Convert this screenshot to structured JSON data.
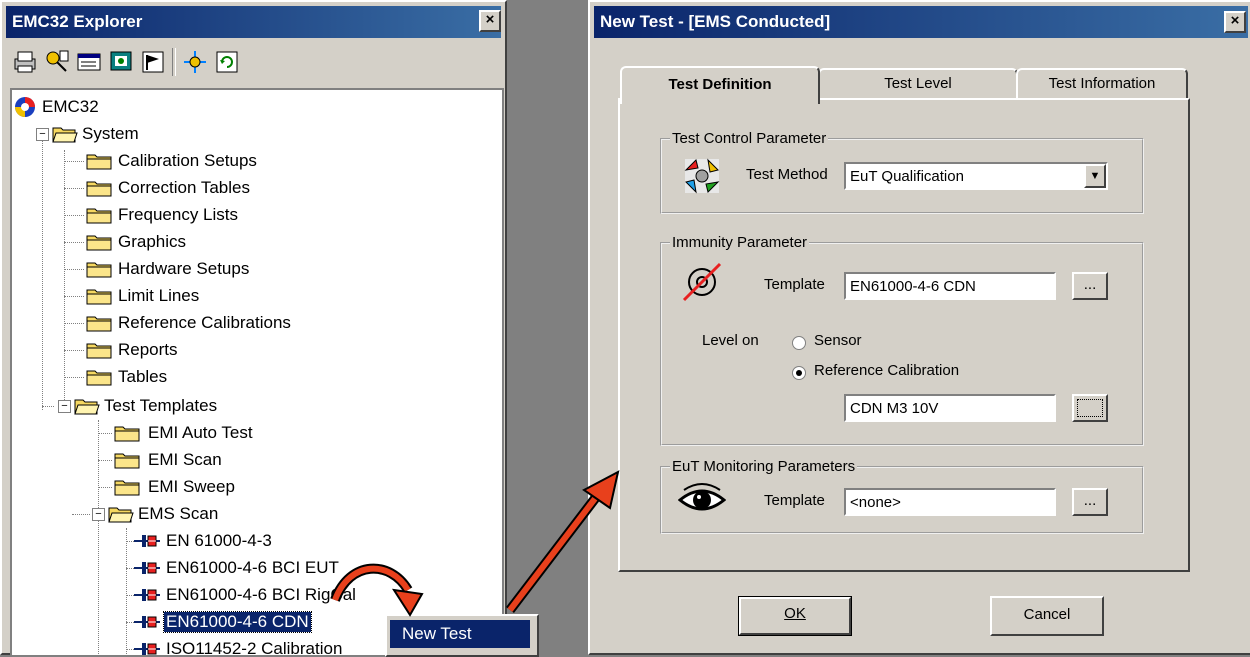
{
  "explorer": {
    "title": "EMC32 Explorer",
    "close": "×",
    "toolbar_icons": [
      "print-icon",
      "key-icon",
      "window-icon",
      "screen-icon",
      "flag-icon",
      "star-icon",
      "refresh-icon"
    ],
    "tree": {
      "root": "EMC32",
      "system": "System",
      "system_children": [
        "Calibration Setups",
        "Correction Tables",
        "Frequency Lists",
        "Graphics",
        "Hardware Setups",
        "Limit Lines",
        "Reference Calibrations",
        "Reports",
        "Tables"
      ],
      "test_templates": "Test Templates",
      "templates_children": [
        "EMI Auto Test",
        "EMI Scan",
        "EMI Sweep"
      ],
      "ems_scan": "EMS Scan",
      "ems_children": [
        "EN 61000-4-3",
        "EN61000-4-6 BCI EUT",
        "EN61000-4-6 BCI RigCal",
        "EN61000-4-6 CDN",
        "ISO11452-2 Calibration"
      ],
      "expander_minus": "−"
    },
    "context_menu": {
      "item": "New Test"
    }
  },
  "dialog": {
    "title": "New Test - [EMS Conducted]",
    "close": "×",
    "tabs": [
      "Test Definition",
      "Test Level",
      "Test Information"
    ],
    "active_tab": "Test Definition",
    "test_control": {
      "legend": "Test Control Parameter",
      "method_label": "Test Method",
      "method_value": "EuT Qualification",
      "dropdown_arrow": "▼"
    },
    "immunity": {
      "legend": "Immunity Parameter",
      "template_label": "Template",
      "template_value": "EN61000-4-6 CDN",
      "browse_label": "...",
      "level_on_label": "Level on",
      "radio_sensor": "Sensor",
      "radio_refcal": "Reference Calibration",
      "selected": "Reference Calibration",
      "refcal_value": "CDN M3 10V",
      "refcal_button": "..."
    },
    "eut_monitoring": {
      "legend": "EuT Monitoring Parameters",
      "template_label": "Template",
      "template_value": "<none>",
      "browse_label": "..."
    },
    "ok_label": "OK",
    "cancel_label": "Cancel"
  },
  "colors": {
    "titlebar": "#0a246a",
    "window_bg": "#d4d0c8",
    "arrow": "#e8401c"
  }
}
